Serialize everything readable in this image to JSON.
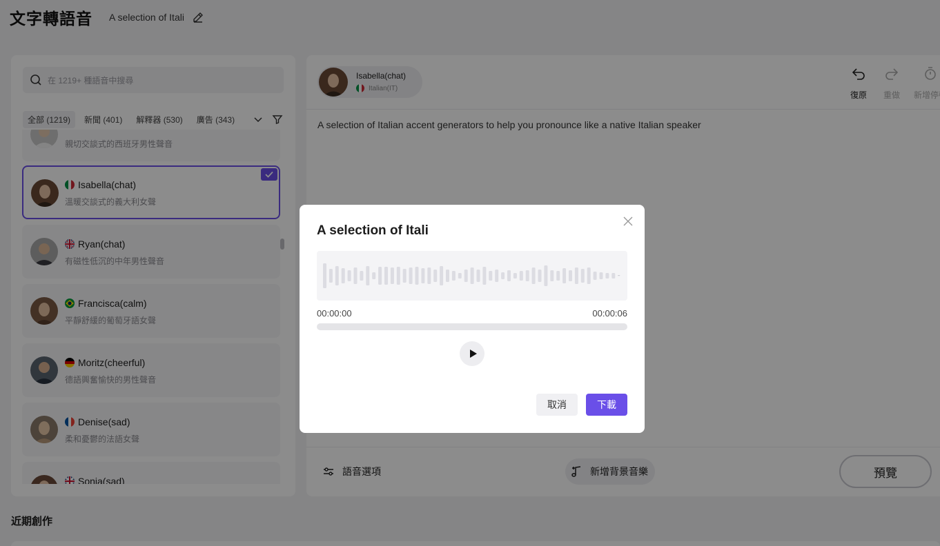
{
  "header": {
    "app_title": "文字轉語音",
    "doc_title": "A selection of Itali"
  },
  "search": {
    "placeholder": "在 1219+ 種語音中搜尋"
  },
  "filters": [
    {
      "label": "全部 (1219)",
      "active": true
    },
    {
      "label": "新聞 (401)",
      "active": false
    },
    {
      "label": "解釋器 (530)",
      "active": false
    },
    {
      "label": "廣告 (343)",
      "active": false
    }
  ],
  "voices": [
    {
      "name": "",
      "desc": "親切交談式的西班牙男性聲音",
      "flag": "",
      "selected": false
    },
    {
      "name": "Isabella(chat)",
      "desc": "溫暖交談式的義大利女聲",
      "flag": "italy",
      "selected": true
    },
    {
      "name": "Ryan(chat)",
      "desc": "有磁性低沉的中年男性聲音",
      "flag": "uk",
      "selected": false
    },
    {
      "name": "Francisca(calm)",
      "desc": "平靜舒緩的葡萄牙語女聲",
      "flag": "brazil",
      "selected": false
    },
    {
      "name": "Moritz(cheerful)",
      "desc": "德語興奮愉快的男性聲音",
      "flag": "germany",
      "selected": false
    },
    {
      "name": "Denise(sad)",
      "desc": "柔和憂鬱的法語女聲",
      "flag": "france",
      "selected": false
    },
    {
      "name": "Sonia(sad)",
      "desc": "",
      "flag": "uk",
      "selected": false
    }
  ],
  "editor": {
    "speaker_name": "Isabella(chat)",
    "speaker_lang": "Italian(IT)",
    "undo_label": "復原",
    "redo_label": "重做",
    "add_pause_label": "新增停頓",
    "text": "A selection of Italian accent generators to help you pronounce like a native Italian speaker",
    "voice_options_label": "語音選項",
    "bgm_label": "新增背景音樂",
    "preview_label": "預覽"
  },
  "recent": {
    "title": "近期創作"
  },
  "modal": {
    "title": "A selection of Itali",
    "time_start": "00:00:00",
    "time_end": "00:00:06",
    "progress": 0,
    "cancel_label": "取消",
    "download_label": "下載"
  },
  "colors": {
    "accent": "#6a4fe8",
    "overlay": "rgba(0,0,0,0.45)"
  }
}
